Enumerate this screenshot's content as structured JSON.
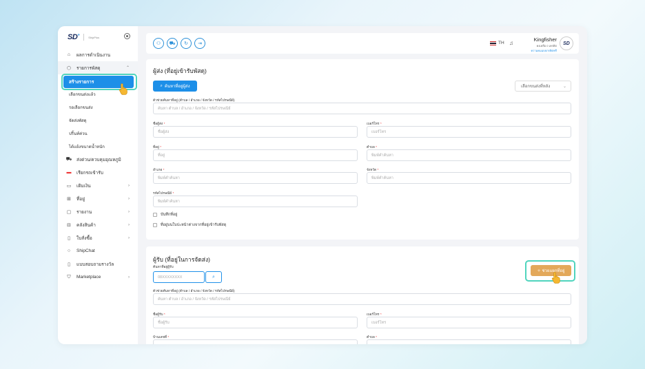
{
  "brand": {
    "logo": "SD",
    "sub": "ShipPlus"
  },
  "sidebar": {
    "items": [
      {
        "label": "ผลการดำเนินงาน",
        "icon": "home-icon"
      },
      {
        "label": "รายการพัสดุ",
        "icon": "box-icon"
      }
    ],
    "active": "สร้างรายการ",
    "sub_items": [
      "เลือกขนส่งแล้ว",
      "รอเลือกขนส่ง",
      "จัดส่งพัสดุ",
      "ปริ้นท์ค่วน",
      "ได้แย้งขนาดน้ำหนัก"
    ],
    "more_items": [
      {
        "label": "ส่งด่วน/ควบคุมอุณหภูมิ",
        "icon": "truck-icon",
        "chev": false
      },
      {
        "label": "เรียกรถเข้ารับ",
        "icon": "car-icon",
        "chev": false
      },
      {
        "label": "เติมเงิน",
        "icon": "wallet-icon",
        "chev": true
      },
      {
        "label": "ที่อยู่",
        "icon": "map-icon",
        "chev": true
      },
      {
        "label": "รายงาน",
        "icon": "folder-icon",
        "chev": true
      },
      {
        "label": "คลังสินค้า",
        "icon": "warehouse-icon",
        "chev": true
      },
      {
        "label": "ใบสั่งซื้อ",
        "icon": "document-icon",
        "chev": true
      },
      {
        "label": "ShipChat",
        "icon": "chat-icon",
        "chev": false
      },
      {
        "label": "แบบสอบถามรางวัล",
        "icon": "survey-icon",
        "chev": false
      },
      {
        "label": "Marketplace",
        "icon": "cart-icon",
        "chev": true
      }
    ]
  },
  "header": {
    "lang": "TH",
    "user_name": "Kingfisher",
    "user_sub": "คงเหลือ 0 เครดิต",
    "user_link": "ความคมแบบกรดิตฟรี"
  },
  "sender": {
    "title": "ผู้ส่ง (ที่อยู่เข้ารับพัสดุ)",
    "search_btn": "ค้นหาที่อยู่ผู้ส่ง",
    "carrier_select": "เลือกขนส่งที่หลัง",
    "helper_label": "ตัวช่วยค้นหาที่อยู่ (ตำบล / อำเภอ / จังหวัด / รหัสไปรษณีย์)",
    "helper_ph": "ค้นหา ตำบล / อำเภอ / จังหวัด / รหัสไปรษณีย์",
    "name_label": "ชื่อผู้ส่ง",
    "name_ph": "ชื่อผู้ส่ง",
    "phone_label": "เบอร์โทร",
    "phone_ph": "เบอร์โทร",
    "addr_label": "ที่อยู่",
    "addr_ph": "ที่อยู่",
    "subdistrict_label": "ตำบล",
    "subdistrict_ph": "พิมพ์คำค้นหา",
    "district_label": "อำเภอ",
    "district_ph": "พิมพ์คำค้นหา",
    "province_label": "จังหวัด",
    "province_ph": "พิมพ์คำค้นหา",
    "zip_label": "รหัสไปรษณีย์",
    "zip_ph": "พิมพ์คำค้นหา",
    "save_chk": "บันทึกที่อยู่",
    "diff_chk": "ที่อยู่บนใบปะหน้าต่างจากที่อยู่เข้ารับพัสดุ"
  },
  "receiver": {
    "title": "ผู้รับ (ที่อยู่ในการจัดส่ง)",
    "find_label": "ค้นหาที่อยู่ผู้รับ",
    "find_ph": "08XXXXXXXX",
    "help_btn": "ช่วยแยกที่อยู่",
    "helper_label": "ตัวช่วยค้นหาที่อยู่ (ตำบล / อำเภอ / จังหวัด / รหัสไปรษณีย์)",
    "helper_ph": "ค้นหา ตำบล / อำเภอ / จังหวัด / รหัสไปรษณีย์",
    "name_label": "ชื่อผู้รับ",
    "name_ph": "ชื่อผู้รับ",
    "phone_label": "เบอร์โทร",
    "phone_ph": "เบอร์โทร",
    "house_label": "บ้านเลขที่",
    "subdistrict_label": "ตำบล"
  },
  "colors": {
    "primary": "#1d8fe8",
    "accent_orange": "#e3a85a",
    "highlight": "#4fd4bd"
  }
}
